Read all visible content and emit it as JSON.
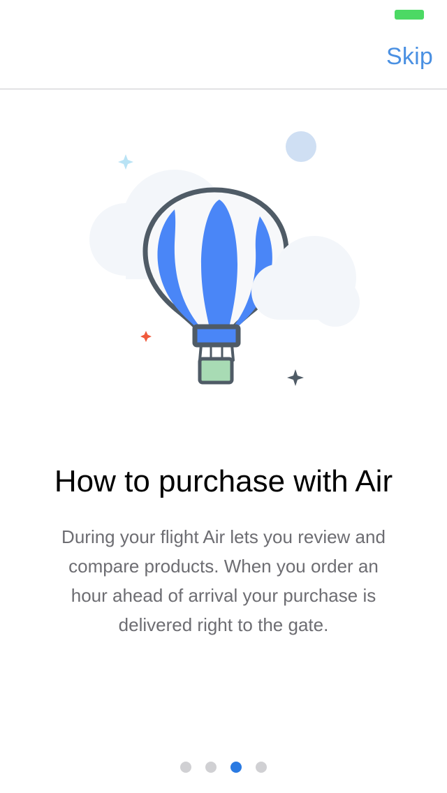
{
  "status_bar": {
    "battery_color": "#4cd964"
  },
  "nav": {
    "skip_label": "Skip",
    "accent_color": "#4a90e2"
  },
  "illustration": {
    "name": "hot-air-balloon-illustration",
    "colors": {
      "balloon_blue": "#4a86f7",
      "balloon_outline": "#4f5b66",
      "basket_fill": "#a8dbb4",
      "cloud": "#f3f6fa",
      "moon": "#cfdff3",
      "star_blue": "#b9e3f5",
      "star_red": "#f05a3c",
      "star_dark": "#4f5b66"
    }
  },
  "onboarding": {
    "title": "How to purchase with Air",
    "description": "During your flight Air lets you review and compare products. When you order an hour ahead of arrival your purchase is delivered right to the gate."
  },
  "pager": {
    "total_pages": 4,
    "current_page": 3,
    "active_color": "#2a7ae2",
    "inactive_color": "#d0d0d3"
  }
}
